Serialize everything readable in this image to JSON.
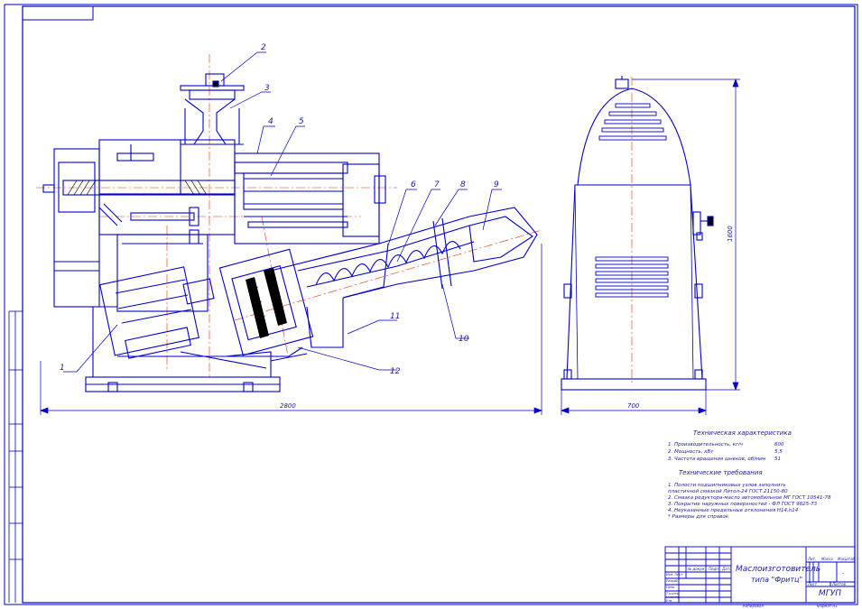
{
  "colors": {
    "frame": "#0000c8",
    "axis": "#e03000",
    "hatch": "#000000",
    "text": "#1a1aa0"
  },
  "callouts": [
    "1",
    "2",
    "3",
    "4",
    "5",
    "6",
    "7",
    "8",
    "9",
    "10",
    "11",
    "12"
  ],
  "dimensions": {
    "overall_length": "2800",
    "side_width": "700",
    "side_height": "1600"
  },
  "specs": {
    "title": "Техническая характеристика",
    "items": [
      {
        "label": "1. Производительность, кг/ч",
        "value": "600"
      },
      {
        "label": "2. Мощность, кВт",
        "value": "5,5"
      },
      {
        "label": "3. Частота вращения шнеков, об/мин",
        "value": "51"
      }
    ]
  },
  "requirements": {
    "title": "Технические требования",
    "items": [
      "1. Полости подшипниковых узлов заполнить",
      "   пластичной смазкой Литол-24 ГОСТ 21150-80",
      "2. Смазка редуктора-масло автомобильное МГ ГОСТ 10541-78",
      "3. Покрытие наружных поверхностей - ФЛ ГОСТ 9825-73",
      "4. Неуказанные предельные отклонения H14,h14",
      "*  Размеры для справок"
    ]
  },
  "title_block": {
    "name_line1": "Маслоизготовитель",
    "name_line2": "типа \"Фритц\"",
    "org": "МГУП",
    "lit": "Лит.",
    "mass": "Масса",
    "scale": "Масштаб",
    "sheet": "Лист",
    "sheets": "Листов",
    "dash": "-",
    "left_rows": [
      "Изм. Лист",
      "Разраб.",
      "Пров.",
      "Т.контр.",
      "Н.контр.",
      "Утв."
    ],
    "cols": [
      "№ докум.",
      "Подп.",
      "Дата"
    ],
    "copied": "Копировал",
    "format": "Формат  А1"
  }
}
